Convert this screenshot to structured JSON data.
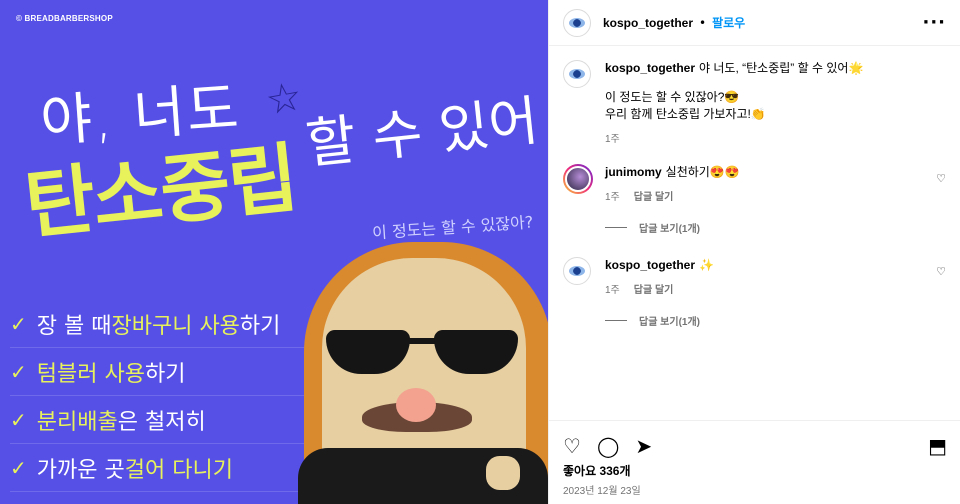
{
  "media": {
    "copyright": "© BREADBARBERSHOP",
    "headline_line1": "야, 너도",
    "headline_highlight": "탄소중립",
    "headline_line2": "할 수 있어",
    "subtitle": "이 정도는 할 수 있잖아?",
    "checklist": [
      {
        "pre": "장 볼 때 ",
        "highlight": "장바구니 사용",
        "post": "하기"
      },
      {
        "pre": "",
        "highlight": "텀블러 사용",
        "post": "하기"
      },
      {
        "pre": "",
        "highlight": "분리배출",
        "post": "은 철저히"
      },
      {
        "pre": "가까운 곳 ",
        "highlight": "걸어 다니기",
        "post": ""
      }
    ],
    "check_mark": "✓",
    "colors": {
      "bg": "#5650e6",
      "highlight": "#e8f25a"
    }
  },
  "header": {
    "username": "kospo_together",
    "separator": "•",
    "follow_label": "팔로우",
    "more_icon": "···"
  },
  "caption": {
    "username": "kospo_together",
    "line1": "야 너도, “탄소중립” 할 수 있어🌟",
    "line2": "이 정도는 할 수 있잖아?😎",
    "line3": "우리 함께 탄소중립 가보자고!👏",
    "time": "1주"
  },
  "comments": [
    {
      "username": "junimomy",
      "text": "실천하기😍😍",
      "time": "1주",
      "reply_label": "답글 달기",
      "view_replies": "답글 보기(1개)"
    },
    {
      "username": "kospo_together",
      "text": "✨",
      "time": "1주",
      "reply_label": "답글 달기",
      "view_replies": "답글 보기(1개)"
    }
  ],
  "actions": {
    "like_icon": "♡",
    "comment_icon": "◯",
    "share_icon": "➤",
    "save_icon": "⬒"
  },
  "likes": "좋아요 336개",
  "date": "2023년 12월 23일"
}
